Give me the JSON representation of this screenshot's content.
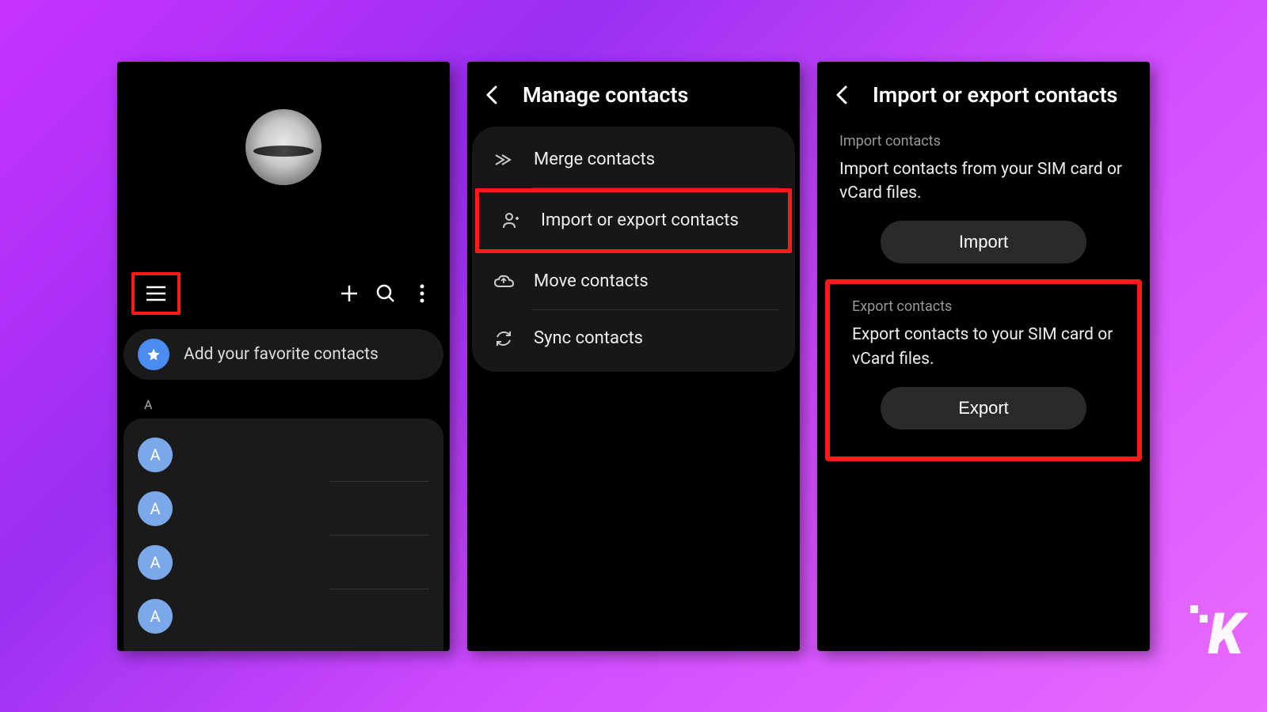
{
  "screen1": {
    "favorites_label": "Add your favorite contacts",
    "section_letter": "A",
    "contact_initial": "A"
  },
  "screen2": {
    "title": "Manage contacts",
    "items": [
      {
        "label": "Merge contacts"
      },
      {
        "label": "Import or export contacts"
      },
      {
        "label": "Move contacts"
      },
      {
        "label": "Sync contacts"
      }
    ]
  },
  "screen3": {
    "title": "Import or export contacts",
    "import_section": "Import contacts",
    "import_desc": "Import contacts from your SIM card or vCard files.",
    "import_button": "Import",
    "export_section": "Export contacts",
    "export_desc": "Export contacts to your SIM card or vCard files.",
    "export_button": "Export"
  },
  "watermark": "K"
}
